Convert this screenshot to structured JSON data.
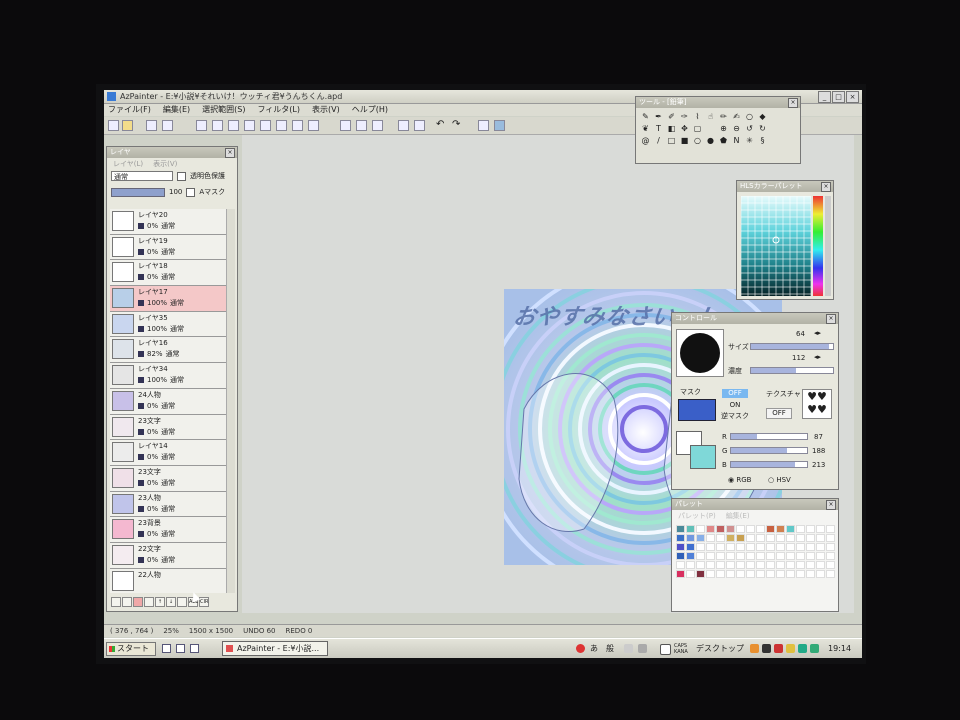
{
  "window": {
    "title": "AzPainter - E:¥小説¥それいけ！ウッチィ君¥うんちくん.apd"
  },
  "menu": [
    "ファイル(F)",
    "編集(E)",
    "選択範囲(S)",
    "フィルタ(L)",
    "表示(V)",
    "ヘルプ(H)"
  ],
  "layer_panel": {
    "title": "レイヤ",
    "submenu": [
      "レイヤ(L)",
      "表示(V)"
    ],
    "blend_mode": "通常",
    "protect_label": "透明色保護",
    "opacity": "100",
    "amask_label": "Aマスク",
    "layers": [
      {
        "name": "レイヤ20",
        "opacity": "0%",
        "mode": "通常",
        "selected": false
      },
      {
        "name": "レイヤ19",
        "opacity": "0%",
        "mode": "通常",
        "selected": false
      },
      {
        "name": "レイヤ18",
        "opacity": "0%",
        "mode": "通常",
        "selected": false
      },
      {
        "name": "レイヤ17",
        "opacity": "100%",
        "mode": "通常",
        "selected": true
      },
      {
        "name": "レイヤ35",
        "opacity": "100%",
        "mode": "通常",
        "selected": false
      },
      {
        "name": "レイヤ16",
        "opacity": "82%",
        "mode": "通常",
        "selected": false
      },
      {
        "name": "レイヤ34",
        "opacity": "100%",
        "mode": "通常",
        "selected": false
      },
      {
        "name": "24人物",
        "opacity": "0%",
        "mode": "通常",
        "selected": false
      },
      {
        "name": "23文字",
        "opacity": "0%",
        "mode": "通常",
        "selected": false
      },
      {
        "name": "レイヤ14",
        "opacity": "0%",
        "mode": "通常",
        "selected": false
      },
      {
        "name": "23文字",
        "opacity": "0%",
        "mode": "通常",
        "selected": false
      },
      {
        "name": "23人物",
        "opacity": "0%",
        "mode": "通常",
        "selected": false
      },
      {
        "name": "23背景",
        "opacity": "0%",
        "mode": "通常",
        "selected": false
      },
      {
        "name": "22文字",
        "opacity": "0%",
        "mode": "通常",
        "selected": false
      },
      {
        "name": "22人物",
        "opacity": "",
        "mode": "",
        "selected": false
      }
    ],
    "bottom_buttons": [
      "ALL",
      "CIR"
    ]
  },
  "tool_panel": {
    "title": "ツール - [鉛筆]"
  },
  "hls_panel": {
    "title": "HLSカラーパレット"
  },
  "control_panel": {
    "title": "コントロール",
    "size_label": "サイズ",
    "size_value": "64",
    "density_label": "濃度",
    "density_value": "112",
    "mask_label": "マスク",
    "mask_options": [
      "OFF",
      "ON",
      "逆マスク"
    ],
    "texture_label": "テクスチャ",
    "texture_value": "OFF",
    "rgb": {
      "r": "87",
      "g": "188",
      "b": "213"
    },
    "color_mode_options": [
      "RGB",
      "HSV"
    ],
    "size_fraction": 0.95,
    "density_fraction": 0.55,
    "r_fraction": 0.34,
    "g_fraction": 0.74,
    "b_fraction": 0.84
  },
  "palette_panel": {
    "title": "パレット",
    "submenu": [
      "パレット(P)",
      "編集(E)"
    ]
  },
  "statusbar": {
    "cursor_pos": "( 376 , 764 )",
    "zoom": "25%",
    "image_size": "1500 x 1500",
    "undo": "UNDO  60",
    "redo": "REDO  0"
  },
  "taskbar": {
    "start_label": "スタート",
    "task_item": "AzPainter - E:¥小説...",
    "ime_a": "あ",
    "ime_mode": "般",
    "caps_top": "CAPS",
    "caps_bottom": "KANA",
    "desktop_label": "デスクトップ",
    "clock": "19:14"
  },
  "canvas": {
    "title_text": "おやすみなさいっ！"
  }
}
